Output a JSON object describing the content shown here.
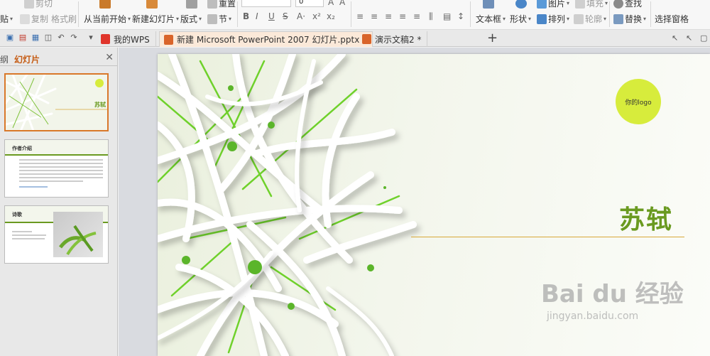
{
  "ribbon": {
    "cut_label": "剪切",
    "paste_label": "贴",
    "copy_label": "复制",
    "format_painter_label": "格式刷",
    "from_current_label": "从当前开始",
    "new_slide_label": "新建幻灯片",
    "layout_label": "版式",
    "reset_label": "重置",
    "section_label": "节",
    "font_size_value": "0",
    "textbox_label": "文本框",
    "shape_label": "形状",
    "picture_label": "图片",
    "fill_label": "填充",
    "arrange_label": "排列",
    "outline_label": "轮廓",
    "find_label": "查找",
    "replace_label": "替换",
    "select_pane_label": "选择窗格"
  },
  "tabs": [
    {
      "label": "我的WPS",
      "icon": "wps-logo-icon"
    },
    {
      "label": "新建 Microsoft PowerPoint 2007 幻灯片.pptx *",
      "icon": "ppt-file-icon",
      "active": true
    },
    {
      "label": "演示文稿2 *",
      "icon": "ppt-file-icon"
    }
  ],
  "left_pane": {
    "outline_tab": "纲",
    "slides_tab": "幻灯片",
    "thumbs": [
      {
        "title": "苏轼",
        "logo": "你的logo"
      },
      {
        "title": "作者介绍"
      },
      {
        "title": "诗歌"
      }
    ]
  },
  "slide": {
    "title": "苏轼",
    "logo_text": "你的logo",
    "accent_color": "#6a9a20",
    "logo_color": "#d7ec3c",
    "line_color": "#d8a838"
  },
  "watermark": {
    "main": "Bai du 经验",
    "sub": "jingyan.baidu.com"
  }
}
